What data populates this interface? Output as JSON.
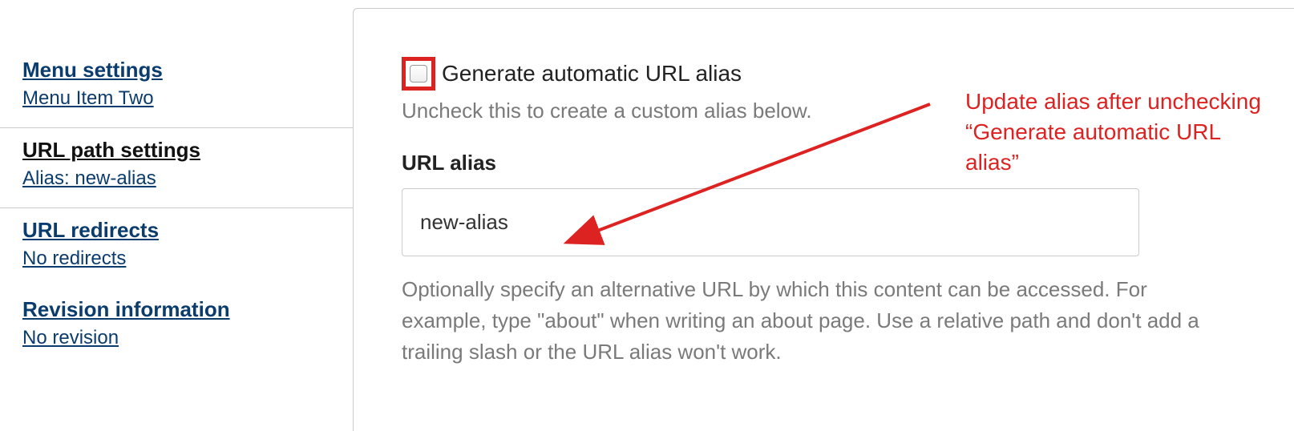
{
  "sidebar": {
    "items": [
      {
        "title": "Menu settings",
        "sub": "Menu Item Two"
      },
      {
        "title": "URL path settings",
        "sub": "Alias: new-alias"
      },
      {
        "title": "URL redirects",
        "sub": "No redirects"
      },
      {
        "title": "Revision information",
        "sub": "No revision"
      }
    ]
  },
  "main": {
    "checkbox_label": "Generate automatic URL alias",
    "checkbox_hint": "Uncheck this to create a custom alias below.",
    "alias_label": "URL alias",
    "alias_value": "new-alias",
    "alias_description": "Optionally specify an alternative URL by which this content can be accessed. For example, type \"about\" when writing an about page. Use a relative path and don't add a trailing slash or the URL alias won't work."
  },
  "annotation": {
    "text": "Update alias after unchecking “Generate automatic URL alias”"
  },
  "colors": {
    "highlight": "#d22",
    "link": "#0b3c6e",
    "muted": "#7a7a7a"
  }
}
